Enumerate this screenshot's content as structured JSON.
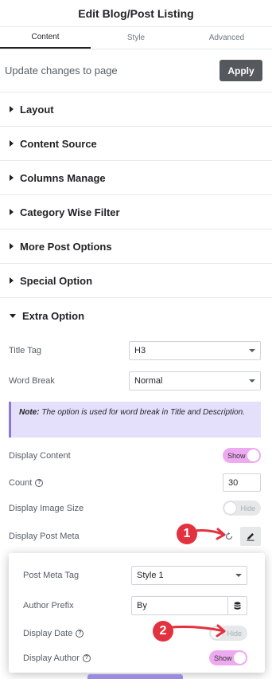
{
  "header": {
    "title": "Edit Blog/Post Listing"
  },
  "tabs": [
    {
      "label": "Content",
      "active": true
    },
    {
      "label": "Style",
      "active": false
    },
    {
      "label": "Advanced",
      "active": false
    }
  ],
  "update": {
    "text": "Update changes to page",
    "apply_label": "Apply"
  },
  "sections": [
    {
      "label": "Layout"
    },
    {
      "label": "Content Source"
    },
    {
      "label": "Columns Manage"
    },
    {
      "label": "Category Wise Filter"
    },
    {
      "label": "More Post Options"
    },
    {
      "label": "Special Option"
    }
  ],
  "extra": {
    "label": "Extra Option",
    "title_tag": {
      "label": "Title Tag",
      "value": "H3"
    },
    "word_break": {
      "label": "Word Break",
      "value": "Normal"
    },
    "note": {
      "bold": "Note:",
      "text": " The option is used for word break in Title and Description."
    },
    "display_content": {
      "label": "Display Content",
      "value": "Show",
      "on": true
    },
    "count": {
      "label": "Count",
      "value": "30"
    },
    "display_image_size": {
      "label": "Display Image Size",
      "value": "Hide",
      "on": false
    },
    "display_post_meta": {
      "label": "Display Post Meta"
    }
  },
  "popup": {
    "meta_tag": {
      "label": "Post Meta Tag",
      "value": "Style 1"
    },
    "author_prefix": {
      "label": "Author Prefix",
      "value": "By"
    },
    "display_date": {
      "label": "Display Date",
      "value": "Hide",
      "on": false
    },
    "display_author": {
      "label": "Display Author",
      "value": "Show",
      "on": true
    }
  },
  "markers": [
    {
      "label": "1"
    },
    {
      "label": "2"
    }
  ],
  "help_glyph": "?",
  "colors": {
    "accent_toggle": "#eeaaf0",
    "apply": "#55585c",
    "note_bg": "#e4dffb",
    "marker": "#e3323f"
  }
}
